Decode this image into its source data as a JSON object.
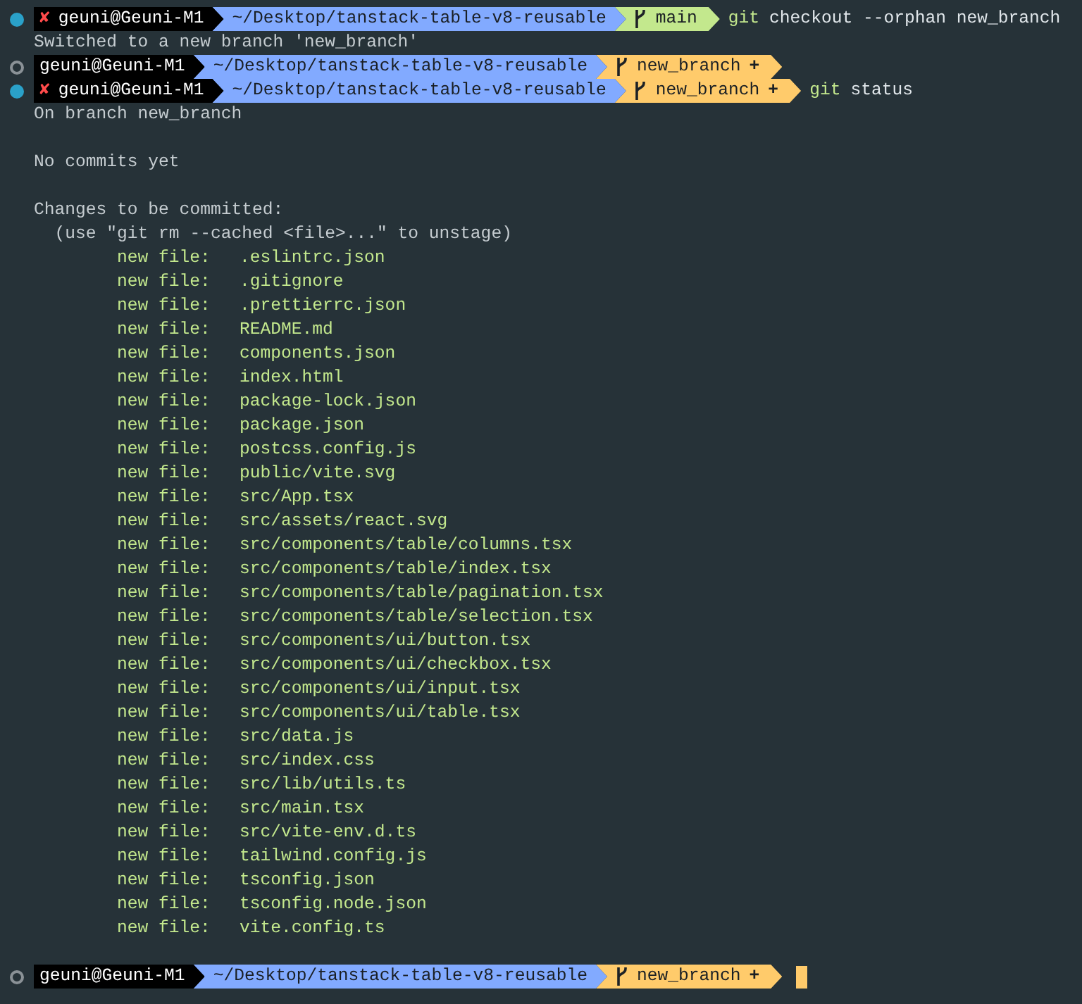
{
  "lines": [
    {
      "kind": "prompt",
      "ran": true,
      "error_mark": "✘",
      "user": "geuni@Geuni-M1",
      "path": "~/Desktop/tanstack-table-v8-reusable",
      "branch": "main",
      "color": "#c3e88d",
      "command": "git",
      "args": "checkout --orphan new_branch"
    },
    {
      "kind": "output",
      "text": "Switched to a new branch 'new_branch'"
    },
    {
      "kind": "prompt",
      "ran": false,
      "user": "geuni@Geuni-M1",
      "path": "~/Desktop/tanstack-table-v8-reusable",
      "branch": "new_branch",
      "dirty": "+",
      "color": "#ffcb6b"
    },
    {
      "kind": "prompt",
      "ran": true,
      "error_mark": "✘",
      "user": "geuni@Geuni-M1",
      "path": "~/Desktop/tanstack-table-v8-reusable",
      "branch": "new_branch",
      "dirty": "+",
      "color": "#ffcb6b",
      "command": "git",
      "args": "status"
    },
    {
      "kind": "output",
      "text": "On branch new_branch"
    },
    {
      "kind": "blank"
    },
    {
      "kind": "output",
      "text": "No commits yet"
    },
    {
      "kind": "blank"
    },
    {
      "kind": "output",
      "text": "Changes to be committed:"
    },
    {
      "kind": "output",
      "text": "  (use \"git rm --cached <file>...\" to unstage)"
    },
    {
      "kind": "file",
      "status": "new file:",
      "path": ".eslintrc.json"
    },
    {
      "kind": "file",
      "status": "new file:",
      "path": ".gitignore"
    },
    {
      "kind": "file",
      "status": "new file:",
      "path": ".prettierrc.json"
    },
    {
      "kind": "file",
      "status": "new file:",
      "path": "README.md"
    },
    {
      "kind": "file",
      "status": "new file:",
      "path": "components.json"
    },
    {
      "kind": "file",
      "status": "new file:",
      "path": "index.html"
    },
    {
      "kind": "file",
      "status": "new file:",
      "path": "package-lock.json"
    },
    {
      "kind": "file",
      "status": "new file:",
      "path": "package.json"
    },
    {
      "kind": "file",
      "status": "new file:",
      "path": "postcss.config.js"
    },
    {
      "kind": "file",
      "status": "new file:",
      "path": "public/vite.svg"
    },
    {
      "kind": "file",
      "status": "new file:",
      "path": "src/App.tsx"
    },
    {
      "kind": "file",
      "status": "new file:",
      "path": "src/assets/react.svg"
    },
    {
      "kind": "file",
      "status": "new file:",
      "path": "src/components/table/columns.tsx"
    },
    {
      "kind": "file",
      "status": "new file:",
      "path": "src/components/table/index.tsx"
    },
    {
      "kind": "file",
      "status": "new file:",
      "path": "src/components/table/pagination.tsx"
    },
    {
      "kind": "file",
      "status": "new file:",
      "path": "src/components/table/selection.tsx"
    },
    {
      "kind": "file",
      "status": "new file:",
      "path": "src/components/ui/button.tsx"
    },
    {
      "kind": "file",
      "status": "new file:",
      "path": "src/components/ui/checkbox.tsx"
    },
    {
      "kind": "file",
      "status": "new file:",
      "path": "src/components/ui/input.tsx"
    },
    {
      "kind": "file",
      "status": "new file:",
      "path": "src/components/ui/table.tsx"
    },
    {
      "kind": "file",
      "status": "new file:",
      "path": "src/data.js"
    },
    {
      "kind": "file",
      "status": "new file:",
      "path": "src/index.css"
    },
    {
      "kind": "file",
      "status": "new file:",
      "path": "src/lib/utils.ts"
    },
    {
      "kind": "file",
      "status": "new file:",
      "path": "src/main.tsx"
    },
    {
      "kind": "file",
      "status": "new file:",
      "path": "src/vite-env.d.ts"
    },
    {
      "kind": "file",
      "status": "new file:",
      "path": "tailwind.config.js"
    },
    {
      "kind": "file",
      "status": "new file:",
      "path": "tsconfig.json"
    },
    {
      "kind": "file",
      "status": "new file:",
      "path": "tsconfig.node.json"
    },
    {
      "kind": "file",
      "status": "new file:",
      "path": "vite.config.ts"
    },
    {
      "kind": "blank"
    },
    {
      "kind": "prompt",
      "ran": false,
      "user": "geuni@Geuni-M1",
      "path": "~/Desktop/tanstack-table-v8-reusable",
      "branch": "new_branch",
      "dirty": "+",
      "color": "#ffcb6b",
      "cursor": true
    }
  ]
}
